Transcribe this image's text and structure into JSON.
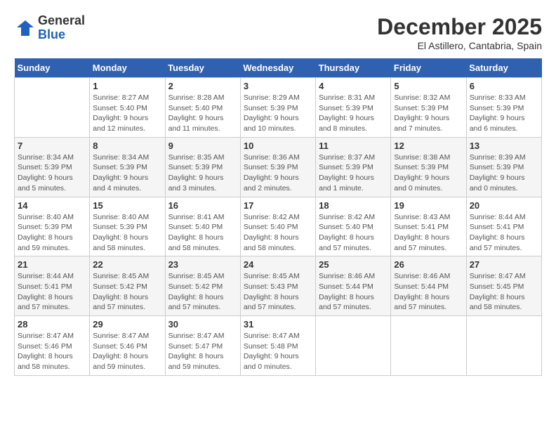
{
  "header": {
    "logo_general": "General",
    "logo_blue": "Blue",
    "month_title": "December 2025",
    "location": "El Astillero, Cantabria, Spain"
  },
  "weekdays": [
    "Sunday",
    "Monday",
    "Tuesday",
    "Wednesday",
    "Thursday",
    "Friday",
    "Saturday"
  ],
  "weeks": [
    [
      {
        "day": "",
        "empty": true
      },
      {
        "day": "1",
        "sunrise": "8:27 AM",
        "sunset": "5:40 PM",
        "daylight": "9 hours and 12 minutes."
      },
      {
        "day": "2",
        "sunrise": "8:28 AM",
        "sunset": "5:40 PM",
        "daylight": "9 hours and 11 minutes."
      },
      {
        "day": "3",
        "sunrise": "8:29 AM",
        "sunset": "5:39 PM",
        "daylight": "9 hours and 10 minutes."
      },
      {
        "day": "4",
        "sunrise": "8:31 AM",
        "sunset": "5:39 PM",
        "daylight": "9 hours and 8 minutes."
      },
      {
        "day": "5",
        "sunrise": "8:32 AM",
        "sunset": "5:39 PM",
        "daylight": "9 hours and 7 minutes."
      },
      {
        "day": "6",
        "sunrise": "8:33 AM",
        "sunset": "5:39 PM",
        "daylight": "9 hours and 6 minutes."
      }
    ],
    [
      {
        "day": "7",
        "sunrise": "8:34 AM",
        "sunset": "5:39 PM",
        "daylight": "9 hours and 5 minutes."
      },
      {
        "day": "8",
        "sunrise": "8:34 AM",
        "sunset": "5:39 PM",
        "daylight": "9 hours and 4 minutes."
      },
      {
        "day": "9",
        "sunrise": "8:35 AM",
        "sunset": "5:39 PM",
        "daylight": "9 hours and 3 minutes."
      },
      {
        "day": "10",
        "sunrise": "8:36 AM",
        "sunset": "5:39 PM",
        "daylight": "9 hours and 2 minutes."
      },
      {
        "day": "11",
        "sunrise": "8:37 AM",
        "sunset": "5:39 PM",
        "daylight": "9 hours and 1 minute."
      },
      {
        "day": "12",
        "sunrise": "8:38 AM",
        "sunset": "5:39 PM",
        "daylight": "9 hours and 0 minutes."
      },
      {
        "day": "13",
        "sunrise": "8:39 AM",
        "sunset": "5:39 PM",
        "daylight": "9 hours and 0 minutes."
      }
    ],
    [
      {
        "day": "14",
        "sunrise": "8:40 AM",
        "sunset": "5:39 PM",
        "daylight": "8 hours and 59 minutes."
      },
      {
        "day": "15",
        "sunrise": "8:40 AM",
        "sunset": "5:39 PM",
        "daylight": "8 hours and 58 minutes."
      },
      {
        "day": "16",
        "sunrise": "8:41 AM",
        "sunset": "5:40 PM",
        "daylight": "8 hours and 58 minutes."
      },
      {
        "day": "17",
        "sunrise": "8:42 AM",
        "sunset": "5:40 PM",
        "daylight": "8 hours and 58 minutes."
      },
      {
        "day": "18",
        "sunrise": "8:42 AM",
        "sunset": "5:40 PM",
        "daylight": "8 hours and 57 minutes."
      },
      {
        "day": "19",
        "sunrise": "8:43 AM",
        "sunset": "5:41 PM",
        "daylight": "8 hours and 57 minutes."
      },
      {
        "day": "20",
        "sunrise": "8:44 AM",
        "sunset": "5:41 PM",
        "daylight": "8 hours and 57 minutes."
      }
    ],
    [
      {
        "day": "21",
        "sunrise": "8:44 AM",
        "sunset": "5:41 PM",
        "daylight": "8 hours and 57 minutes."
      },
      {
        "day": "22",
        "sunrise": "8:45 AM",
        "sunset": "5:42 PM",
        "daylight": "8 hours and 57 minutes."
      },
      {
        "day": "23",
        "sunrise": "8:45 AM",
        "sunset": "5:42 PM",
        "daylight": "8 hours and 57 minutes."
      },
      {
        "day": "24",
        "sunrise": "8:45 AM",
        "sunset": "5:43 PM",
        "daylight": "8 hours and 57 minutes."
      },
      {
        "day": "25",
        "sunrise": "8:46 AM",
        "sunset": "5:44 PM",
        "daylight": "8 hours and 57 minutes."
      },
      {
        "day": "26",
        "sunrise": "8:46 AM",
        "sunset": "5:44 PM",
        "daylight": "8 hours and 57 minutes."
      },
      {
        "day": "27",
        "sunrise": "8:47 AM",
        "sunset": "5:45 PM",
        "daylight": "8 hours and 58 minutes."
      }
    ],
    [
      {
        "day": "28",
        "sunrise": "8:47 AM",
        "sunset": "5:46 PM",
        "daylight": "8 hours and 58 minutes."
      },
      {
        "day": "29",
        "sunrise": "8:47 AM",
        "sunset": "5:46 PM",
        "daylight": "8 hours and 59 minutes."
      },
      {
        "day": "30",
        "sunrise": "8:47 AM",
        "sunset": "5:47 PM",
        "daylight": "8 hours and 59 minutes."
      },
      {
        "day": "31",
        "sunrise": "8:47 AM",
        "sunset": "5:48 PM",
        "daylight": "9 hours and 0 minutes."
      },
      {
        "day": "",
        "empty": true
      },
      {
        "day": "",
        "empty": true
      },
      {
        "day": "",
        "empty": true
      }
    ]
  ]
}
